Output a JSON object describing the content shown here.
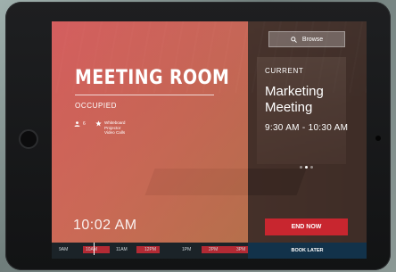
{
  "room": {
    "title": "MEETING ROOM",
    "status": "OCCUPIED",
    "capacity": "6",
    "amenities": [
      "Whiteboard",
      "Projector",
      "Video Calls"
    ],
    "clock": "10:02 AM"
  },
  "browse": {
    "label": "Browse"
  },
  "current": {
    "label": "CURRENT",
    "title": "Marketing Meeting",
    "time": "9:30 AM - 10:30 AM"
  },
  "pager": {
    "count": 3,
    "active_index": 1
  },
  "actions": {
    "end_now": "END NOW",
    "book_later": "BOOK LATER"
  },
  "timeline": {
    "hours": [
      "9AM",
      "10AM",
      "11AM",
      "12PM",
      "1PM",
      "2PM",
      "3PM"
    ],
    "current_time": "10:02 AM"
  },
  "colors": {
    "occupied_overlay": "#e25c60",
    "end_button": "#c8262f",
    "book_later": "#12324a",
    "busy_block": "#b32a34"
  }
}
